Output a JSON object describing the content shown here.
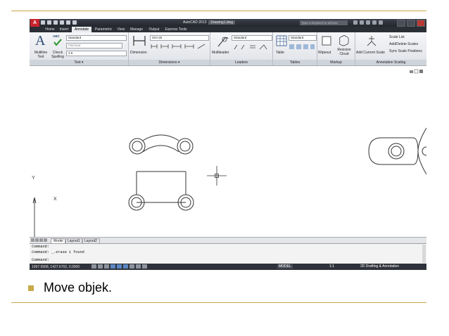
{
  "app": {
    "logo": "A",
    "product": "AutoCAD 2013",
    "document": "Drawing1.dwg",
    "search_placeholder": "Type a keyword or phrase"
  },
  "ribbon_tabs": [
    {
      "label": "Home",
      "active": false
    },
    {
      "label": "Insert",
      "active": false
    },
    {
      "label": "Annotate",
      "active": true
    },
    {
      "label": "Parametric",
      "active": false
    },
    {
      "label": "View",
      "active": false
    },
    {
      "label": "Manage",
      "active": false
    },
    {
      "label": "Output",
      "active": false
    },
    {
      "label": "Express Tools",
      "active": false
    }
  ],
  "text_panel": {
    "multiline_text": "Multiline Text",
    "check_spelling": "Check Spelling",
    "abc": "ABC",
    "text_style": "Standard",
    "find_text": "Find text",
    "text_height": "2.5",
    "panel_label": "Text ▾"
  },
  "dimensions_panel": {
    "dimension": "Dimension",
    "dim_style": "ISO-25",
    "panel_label": "Dimensions ▾"
  },
  "leaders_panel": {
    "multileader": "Multileader",
    "leader_style": "Standard",
    "panel_label": "Leaders"
  },
  "tables_panel": {
    "table": "Table",
    "table_style": "Standard",
    "panel_label": "Tables"
  },
  "markup_panel": {
    "wipeout": "Wipeout",
    "revision_cloud": "Revision Cloud",
    "panel_label": "Markup"
  },
  "scaling_panel": {
    "add_current_scale": "Add Current Scale",
    "scale_list": "Scale List",
    "add_delete_scales": "Add/Delete Scales",
    "sync_scale_positions": "Sync Scale Positions",
    "panel_label": "Annotation Scaling"
  },
  "layout_tabs": [
    "Model",
    "Layout1",
    "Layout2"
  ],
  "ucs": {
    "x": "X",
    "y": "Y"
  },
  "command_history": [
    "Command:",
    "Command: _.erase 1 found",
    "Command:"
  ],
  "status": {
    "coordinates": "1997.9968, 1427.6702, 0.0000",
    "model": "MODEL",
    "scale": "1:1",
    "workspace": "2D Drafting & Annotation"
  },
  "slide": {
    "bullet_text": "Move objek."
  },
  "colors": {
    "gold_accent": "#c8a84a",
    "autocad_red": "#c8232c",
    "ribbon_dark": "#2b2e35"
  }
}
